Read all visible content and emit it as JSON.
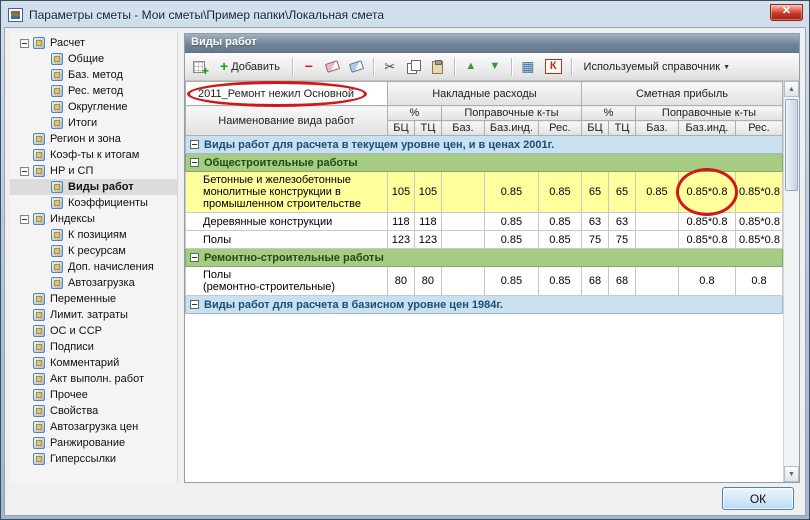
{
  "window": {
    "title": "Параметры сметы - Мои сметы\\Пример папки\\Локальная смета",
    "close_glyph": "✕"
  },
  "colors": {
    "annotation_red": "#d01818",
    "highlight_row_yellow": "#ffff9e",
    "section_green": "#a5cc82",
    "section_blue": "#c8e0f0"
  },
  "sidebar": {
    "items": [
      {
        "label": "Расчет",
        "level": 0,
        "parent": true
      },
      {
        "label": "Общие",
        "level": 1
      },
      {
        "label": "Баз. метод",
        "level": 1
      },
      {
        "label": "Рес. метод",
        "level": 1
      },
      {
        "label": "Округление",
        "level": 1
      },
      {
        "label": "Итоги",
        "level": 1
      },
      {
        "label": "Регион и зона",
        "level": 0
      },
      {
        "label": "Коэф-ты к итогам",
        "level": 0
      },
      {
        "label": "НР и СП",
        "level": 0,
        "parent": true
      },
      {
        "label": "Виды работ",
        "level": 1,
        "selected": true
      },
      {
        "label": "Коэффициенты",
        "level": 1
      },
      {
        "label": "Индексы",
        "level": 0,
        "parent": true
      },
      {
        "label": "К позициям",
        "level": 1
      },
      {
        "label": "К ресурсам",
        "level": 1
      },
      {
        "label": "Доп. начисления",
        "level": 1
      },
      {
        "label": "Автозагрузка",
        "level": 1
      },
      {
        "label": "Переменные",
        "level": 0
      },
      {
        "label": "Лимит. затраты",
        "level": 0
      },
      {
        "label": "ОС и ССР",
        "level": 0
      },
      {
        "label": "Подписи",
        "level": 0
      },
      {
        "label": "Комментарий",
        "level": 0
      },
      {
        "label": "Акт выполн. работ",
        "level": 0
      },
      {
        "label": "Прочее",
        "level": 0
      },
      {
        "label": "Свойства",
        "level": 0
      },
      {
        "label": "Автозагрузка цен",
        "level": 0
      },
      {
        "label": "Ранжирование",
        "level": 0
      },
      {
        "label": "Гиперссылки",
        "level": 0
      }
    ]
  },
  "panel": {
    "caption": "Виды работ",
    "toolbar": {
      "add_label": "Добавить",
      "k_label": "К",
      "reference_label": "Используемый справочник"
    },
    "combo_value": "2011_Ремонт нежил Основной",
    "table": {
      "headers": {
        "name": "Наименование вида работ",
        "overhead": "Накладные расходы",
        "profit": "Сметная прибыль",
        "percent": "%",
        "corrections": "Поправочные к-ты",
        "bc": "БЦ",
        "tc": "ТЦ",
        "baz": "Баз.",
        "bazind": "Баз.инд.",
        "res": "Рес."
      },
      "rows": [
        {
          "type": "section-blue",
          "label": "Виды работ для расчета в текущем уровне цен, и в ценах 2001г."
        },
        {
          "type": "section-green",
          "label": "Общестроительные работы"
        },
        {
          "type": "data",
          "highlight": true,
          "circle": 8,
          "name": "Бетонные и железобетонные монолитные конструкции в промышленном строительстве",
          "values": [
            "105",
            "105",
            "",
            "0.85",
            "0.85",
            "65",
            "65",
            "0.85",
            "0.85*0.8",
            "0.85*0.8"
          ]
        },
        {
          "type": "data",
          "name": "Деревянные конструкции",
          "values": [
            "118",
            "118",
            "",
            "0.85",
            "0.85",
            "63",
            "63",
            "",
            "0.85*0.8",
            "0.85*0.8"
          ]
        },
        {
          "type": "data",
          "name": "Полы",
          "values": [
            "123",
            "123",
            "",
            "0.85",
            "0.85",
            "75",
            "75",
            "",
            "0.85*0.8",
            "0.85*0.8"
          ]
        },
        {
          "type": "section-green",
          "label": "Ремонтно-строительные работы"
        },
        {
          "type": "data",
          "name": "Полы\n(ремонтно-строительные)",
          "values": [
            "80",
            "80",
            "",
            "0.85",
            "0.85",
            "68",
            "68",
            "",
            "0.8",
            "0.8"
          ]
        },
        {
          "type": "section-blue",
          "label": "Виды работ для расчета в базисном уровне цен 1984г."
        }
      ]
    },
    "ok_label": "ОК"
  }
}
